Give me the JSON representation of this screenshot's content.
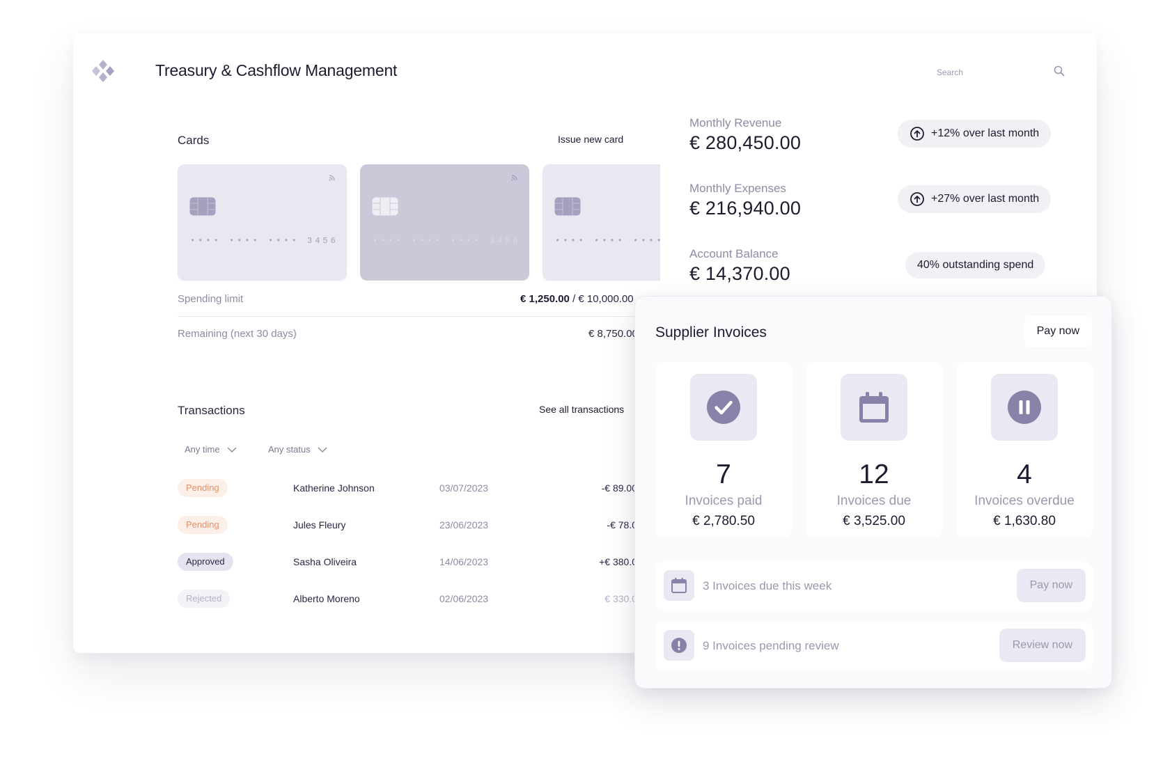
{
  "header": {
    "title": "Treasury & Cashflow Management",
    "logo_icon": "diamond-logo-icon",
    "search_placeholder": "Search"
  },
  "cards": {
    "title": "Cards",
    "issue_label": "Issue new card",
    "items": [
      {
        "number": "•••• •••• •••• 3456",
        "style": "light"
      },
      {
        "number": "•••• •••• •••• 3456",
        "style": "dark"
      },
      {
        "number": "•••• •••• •••• ",
        "style": "light"
      }
    ],
    "spending_limit_label": "Spending limit",
    "spending_limit_used": "€ 1,250.00",
    "spending_limit_total": " / € 10,000.00",
    "remaining_label": "Remaining (next 30 days)",
    "remaining_value": "€ 8,750.00"
  },
  "transactions": {
    "title": "Transactions",
    "see_all_label": "See all transactions",
    "filters": [
      "Any time",
      "Any status"
    ],
    "rows": [
      {
        "status": "Pending",
        "status_key": "pending",
        "name": "Katherine Johnson",
        "date": "03/07/2023",
        "amount": "-€ 89.00"
      },
      {
        "status": "Pending",
        "status_key": "pending",
        "name": "Jules Fleury",
        "date": "23/06/2023",
        "amount": "-€ 78.0"
      },
      {
        "status": "Approved",
        "status_key": "approved",
        "name": "Sasha Oliveira",
        "date": "14/06/2023",
        "amount": "+€ 380.0"
      },
      {
        "status": "Rejected",
        "status_key": "rejected",
        "name": "Alberto Moreno",
        "date": "02/06/2023",
        "amount": "€ 330.0"
      }
    ]
  },
  "kpis": [
    {
      "label": "Monthly Revenue",
      "value": "€ 280,450.00",
      "badge": "+12% over last month",
      "badge_icon": "arrow-up-circle-icon"
    },
    {
      "label": "Monthly Expenses",
      "value": "€ 216,940.00",
      "badge": "+27% over last month",
      "badge_icon": "arrow-up-circle-icon"
    },
    {
      "label": "Account Balance",
      "value": "€ 14,370.00",
      "badge": "40% outstanding spend",
      "badge_icon": ""
    }
  ],
  "invoices": {
    "title": "Supplier Invoices",
    "pay_now_label": "Pay now",
    "stats": [
      {
        "count": "7",
        "label": "Invoices paid",
        "amount": "€ 2,780.50",
        "icon": "check-circle-icon"
      },
      {
        "count": "12",
        "label": "Invoices due",
        "amount": "€ 3,525.00",
        "icon": "calendar-icon"
      },
      {
        "count": "4",
        "label": "Invoices overdue",
        "amount": "€ 1,630.80",
        "icon": "pause-circle-icon"
      }
    ],
    "actions": [
      {
        "text": "3 Invoices due this week",
        "button": "Pay now",
        "icon": "calendar-icon"
      },
      {
        "text": "9 Invoices pending review",
        "button": "Review now",
        "icon": "alert-circle-icon"
      }
    ]
  },
  "colors": {
    "accent": "#8a81a8",
    "accent_light": "#ebe8f3",
    "pending": "#e79168",
    "pending_bg": "#fcefe8",
    "text": "#1d1b2e",
    "muted": "#8f8ba3"
  }
}
